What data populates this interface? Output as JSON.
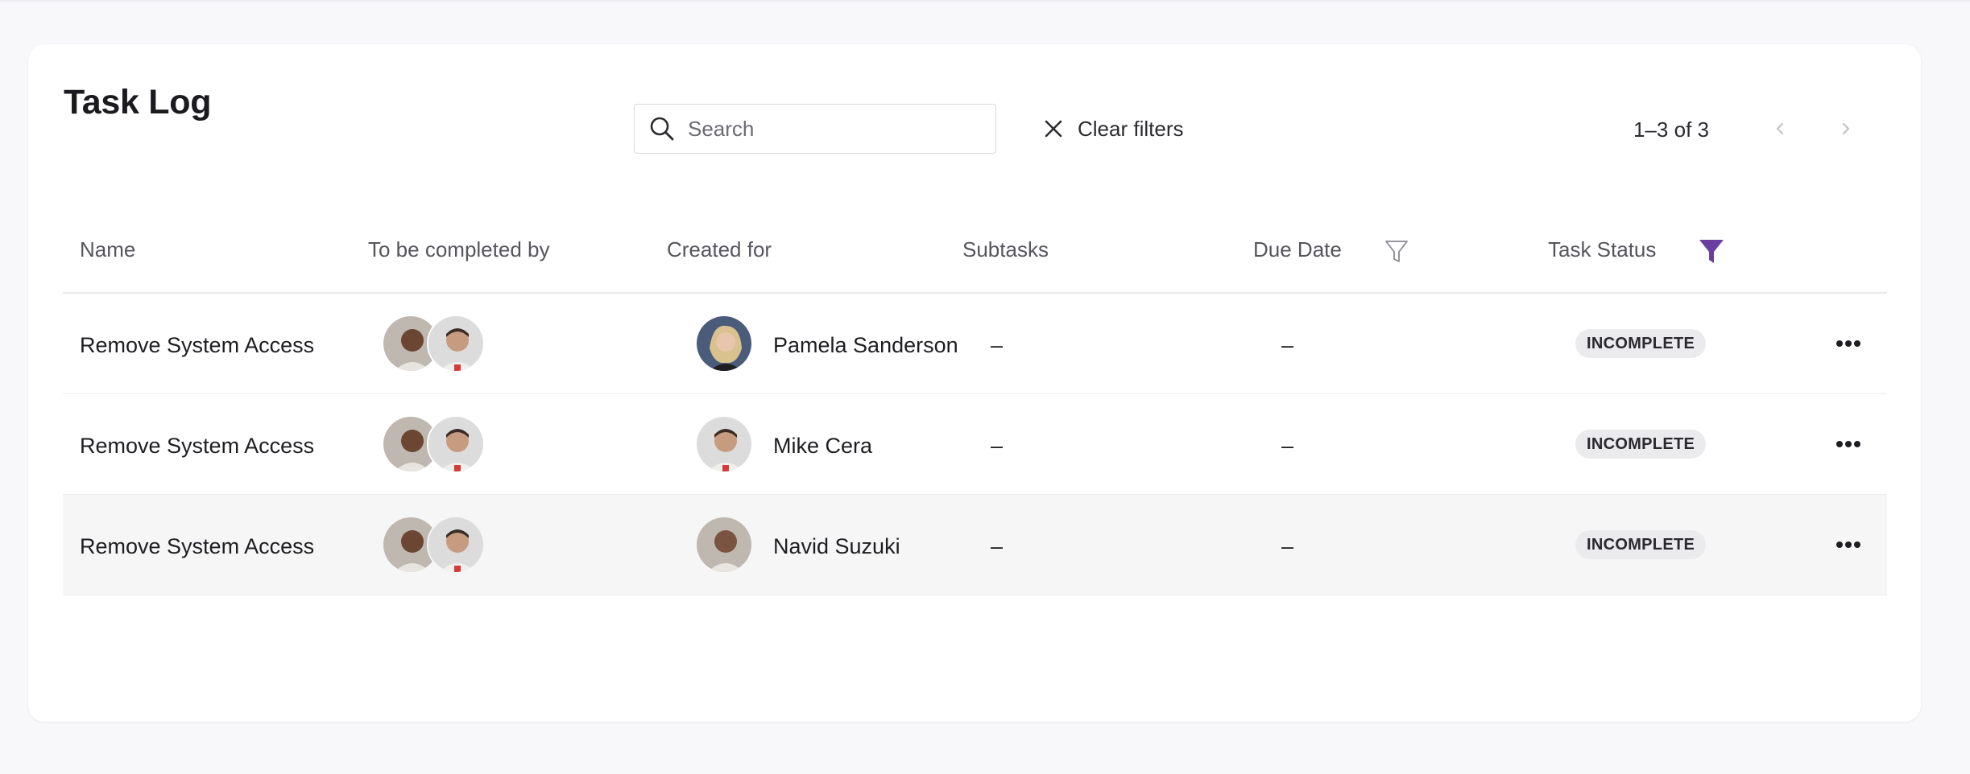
{
  "page": {
    "title": "Task Log"
  },
  "toolbar": {
    "search_placeholder": "Search",
    "search_value": "",
    "clear_filters_label": "Clear filters",
    "pagination_text": "1–3 of 3"
  },
  "table": {
    "columns": [
      {
        "label": "Name"
      },
      {
        "label": "To be completed by"
      },
      {
        "label": "Created for"
      },
      {
        "label": "Subtasks"
      },
      {
        "label": "Due Date",
        "filter_icon": "funnel-outline-icon"
      },
      {
        "label": "Task Status",
        "filter_icon": "funnel-filled-icon",
        "filter_active_color": "#6b3fa0"
      }
    ],
    "rows": [
      {
        "name": "Remove System Access",
        "created_for": "Pamela Sanderson",
        "subtasks": "–",
        "due_date": "–",
        "status": "INCOMPLETE"
      },
      {
        "name": "Remove System Access",
        "created_for": "Mike Cera",
        "subtasks": "–",
        "due_date": "–",
        "status": "INCOMPLETE"
      },
      {
        "name": "Remove System Access",
        "created_for": "Navid Suzuki",
        "subtasks": "–",
        "due_date": "–",
        "status": "INCOMPLETE"
      }
    ]
  },
  "colors": {
    "accent_purple": "#6b3fa0",
    "badge_bg": "#ebebee",
    "hover_row_bg": "#f6f6f7"
  }
}
